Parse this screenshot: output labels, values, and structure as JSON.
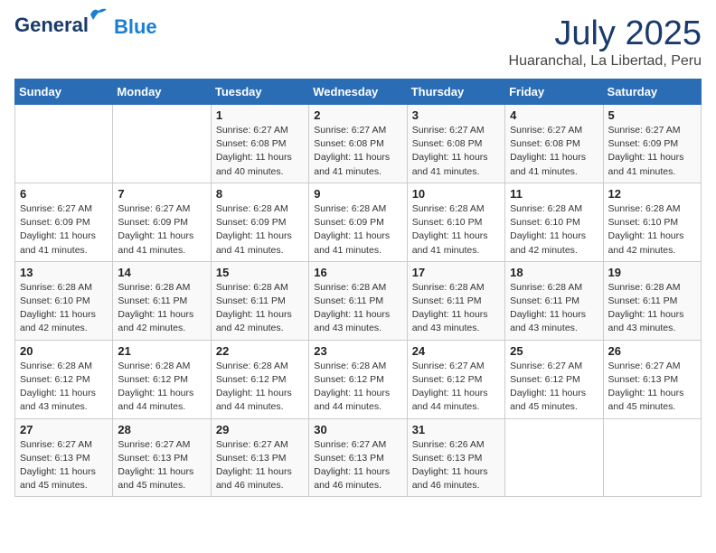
{
  "header": {
    "logo": {
      "general": "General",
      "blue": "Blue"
    },
    "title": "July 2025",
    "location": "Huaranchal, La Libertad, Peru"
  },
  "calendar": {
    "days_of_week": [
      "Sunday",
      "Monday",
      "Tuesday",
      "Wednesday",
      "Thursday",
      "Friday",
      "Saturday"
    ],
    "weeks": [
      [
        {
          "day": "",
          "info": ""
        },
        {
          "day": "",
          "info": ""
        },
        {
          "day": "1",
          "info": "Sunrise: 6:27 AM\nSunset: 6:08 PM\nDaylight: 11 hours\nand 40 minutes."
        },
        {
          "day": "2",
          "info": "Sunrise: 6:27 AM\nSunset: 6:08 PM\nDaylight: 11 hours\nand 41 minutes."
        },
        {
          "day": "3",
          "info": "Sunrise: 6:27 AM\nSunset: 6:08 PM\nDaylight: 11 hours\nand 41 minutes."
        },
        {
          "day": "4",
          "info": "Sunrise: 6:27 AM\nSunset: 6:08 PM\nDaylight: 11 hours\nand 41 minutes."
        },
        {
          "day": "5",
          "info": "Sunrise: 6:27 AM\nSunset: 6:09 PM\nDaylight: 11 hours\nand 41 minutes."
        }
      ],
      [
        {
          "day": "6",
          "info": "Sunrise: 6:27 AM\nSunset: 6:09 PM\nDaylight: 11 hours\nand 41 minutes."
        },
        {
          "day": "7",
          "info": "Sunrise: 6:27 AM\nSunset: 6:09 PM\nDaylight: 11 hours\nand 41 minutes."
        },
        {
          "day": "8",
          "info": "Sunrise: 6:28 AM\nSunset: 6:09 PM\nDaylight: 11 hours\nand 41 minutes."
        },
        {
          "day": "9",
          "info": "Sunrise: 6:28 AM\nSunset: 6:09 PM\nDaylight: 11 hours\nand 41 minutes."
        },
        {
          "day": "10",
          "info": "Sunrise: 6:28 AM\nSunset: 6:10 PM\nDaylight: 11 hours\nand 41 minutes."
        },
        {
          "day": "11",
          "info": "Sunrise: 6:28 AM\nSunset: 6:10 PM\nDaylight: 11 hours\nand 42 minutes."
        },
        {
          "day": "12",
          "info": "Sunrise: 6:28 AM\nSunset: 6:10 PM\nDaylight: 11 hours\nand 42 minutes."
        }
      ],
      [
        {
          "day": "13",
          "info": "Sunrise: 6:28 AM\nSunset: 6:10 PM\nDaylight: 11 hours\nand 42 minutes."
        },
        {
          "day": "14",
          "info": "Sunrise: 6:28 AM\nSunset: 6:11 PM\nDaylight: 11 hours\nand 42 minutes."
        },
        {
          "day": "15",
          "info": "Sunrise: 6:28 AM\nSunset: 6:11 PM\nDaylight: 11 hours\nand 42 minutes."
        },
        {
          "day": "16",
          "info": "Sunrise: 6:28 AM\nSunset: 6:11 PM\nDaylight: 11 hours\nand 43 minutes."
        },
        {
          "day": "17",
          "info": "Sunrise: 6:28 AM\nSunset: 6:11 PM\nDaylight: 11 hours\nand 43 minutes."
        },
        {
          "day": "18",
          "info": "Sunrise: 6:28 AM\nSunset: 6:11 PM\nDaylight: 11 hours\nand 43 minutes."
        },
        {
          "day": "19",
          "info": "Sunrise: 6:28 AM\nSunset: 6:11 PM\nDaylight: 11 hours\nand 43 minutes."
        }
      ],
      [
        {
          "day": "20",
          "info": "Sunrise: 6:28 AM\nSunset: 6:12 PM\nDaylight: 11 hours\nand 43 minutes."
        },
        {
          "day": "21",
          "info": "Sunrise: 6:28 AM\nSunset: 6:12 PM\nDaylight: 11 hours\nand 44 minutes."
        },
        {
          "day": "22",
          "info": "Sunrise: 6:28 AM\nSunset: 6:12 PM\nDaylight: 11 hours\nand 44 minutes."
        },
        {
          "day": "23",
          "info": "Sunrise: 6:28 AM\nSunset: 6:12 PM\nDaylight: 11 hours\nand 44 minutes."
        },
        {
          "day": "24",
          "info": "Sunrise: 6:27 AM\nSunset: 6:12 PM\nDaylight: 11 hours\nand 44 minutes."
        },
        {
          "day": "25",
          "info": "Sunrise: 6:27 AM\nSunset: 6:12 PM\nDaylight: 11 hours\nand 45 minutes."
        },
        {
          "day": "26",
          "info": "Sunrise: 6:27 AM\nSunset: 6:13 PM\nDaylight: 11 hours\nand 45 minutes."
        }
      ],
      [
        {
          "day": "27",
          "info": "Sunrise: 6:27 AM\nSunset: 6:13 PM\nDaylight: 11 hours\nand 45 minutes."
        },
        {
          "day": "28",
          "info": "Sunrise: 6:27 AM\nSunset: 6:13 PM\nDaylight: 11 hours\nand 45 minutes."
        },
        {
          "day": "29",
          "info": "Sunrise: 6:27 AM\nSunset: 6:13 PM\nDaylight: 11 hours\nand 46 minutes."
        },
        {
          "day": "30",
          "info": "Sunrise: 6:27 AM\nSunset: 6:13 PM\nDaylight: 11 hours\nand 46 minutes."
        },
        {
          "day": "31",
          "info": "Sunrise: 6:26 AM\nSunset: 6:13 PM\nDaylight: 11 hours\nand 46 minutes."
        },
        {
          "day": "",
          "info": ""
        },
        {
          "day": "",
          "info": ""
        }
      ]
    ]
  }
}
